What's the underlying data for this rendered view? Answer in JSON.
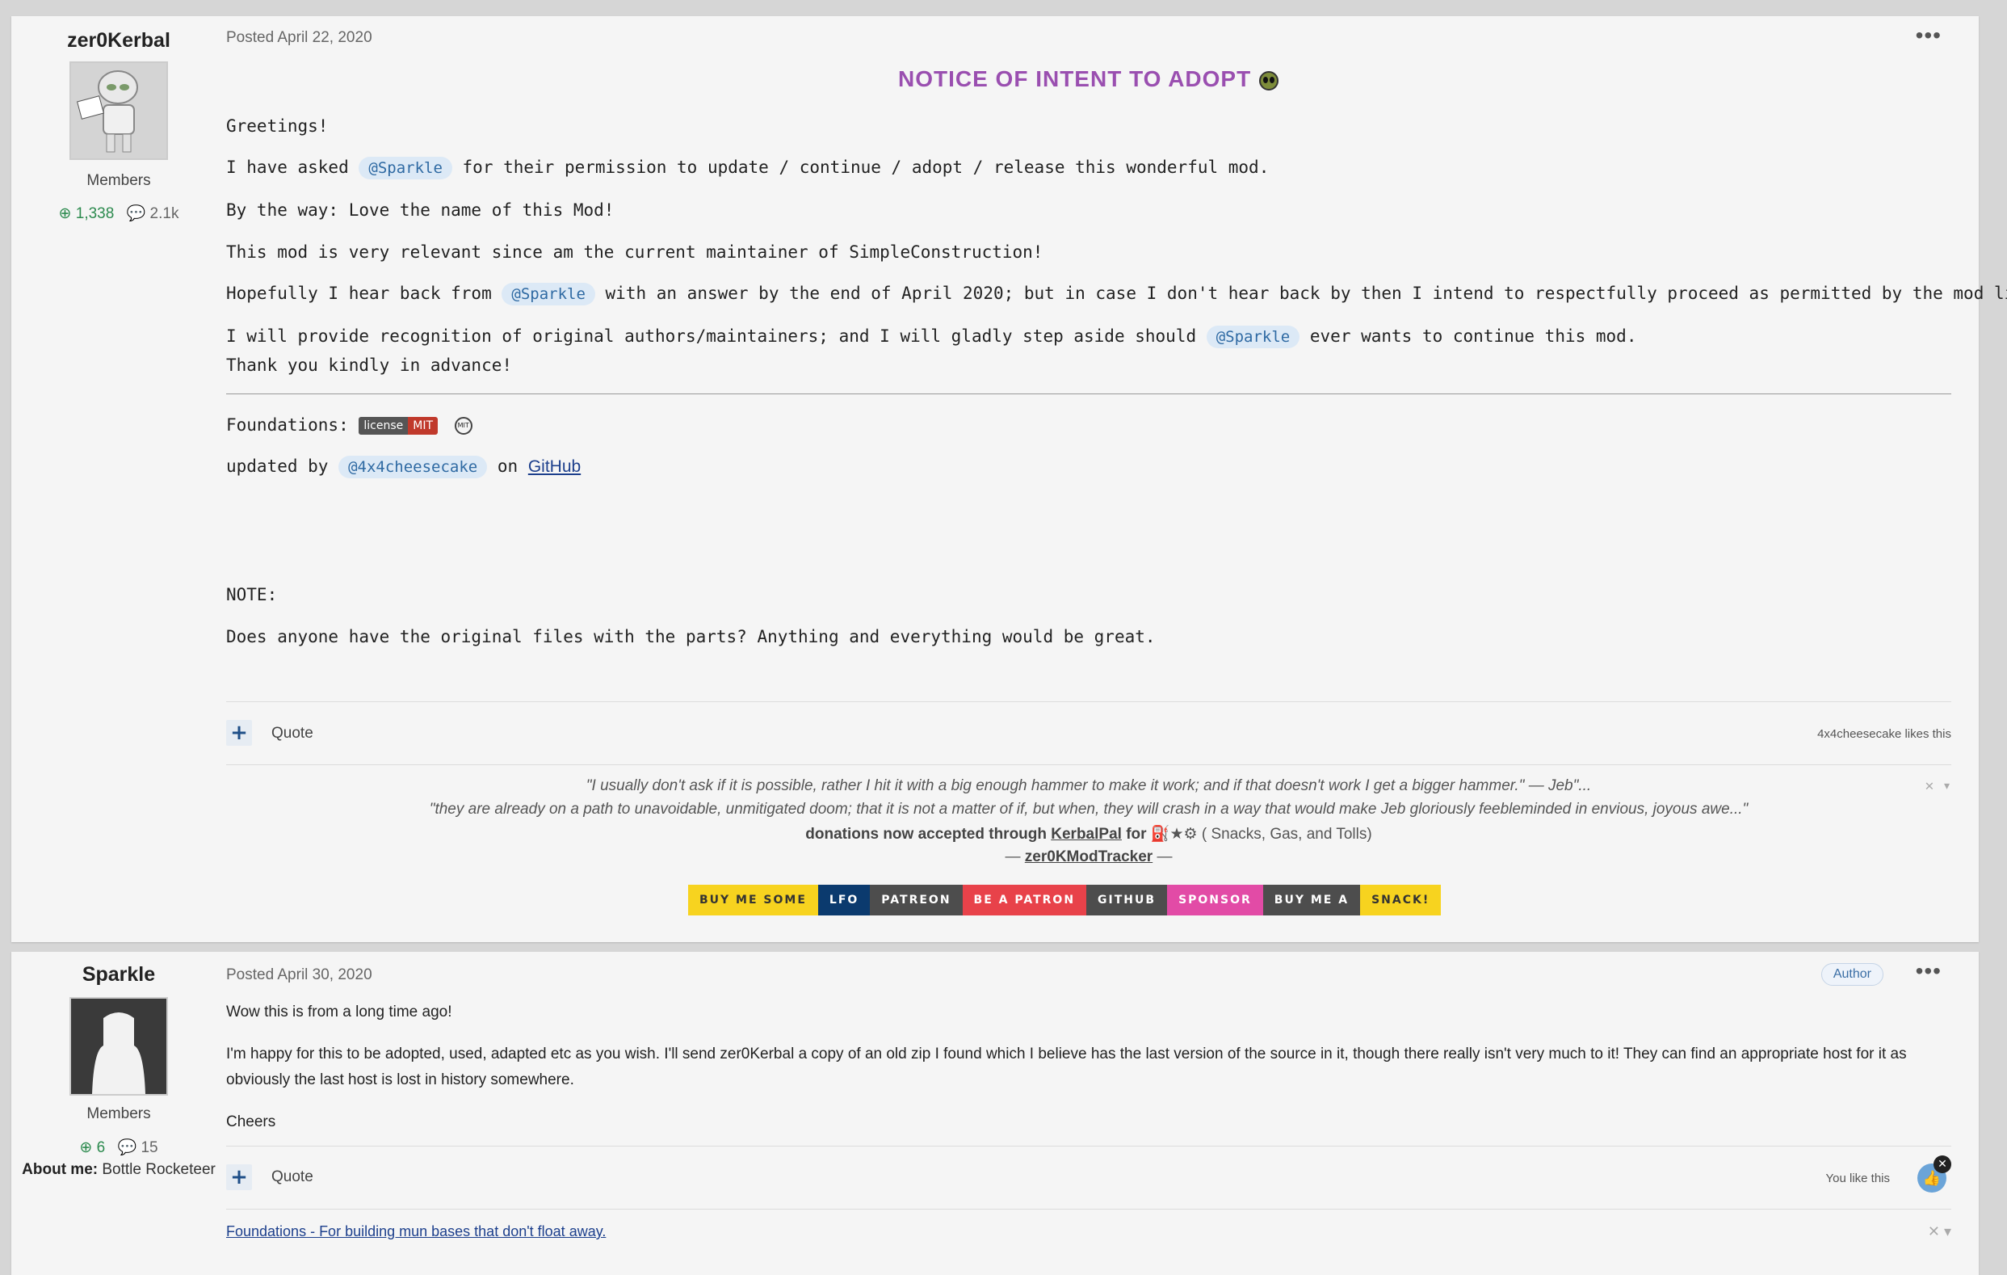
{
  "post1": {
    "author": "zer0Kerbal",
    "group": "Members",
    "reputation": "1,338",
    "post_count": "2.1k",
    "posted": "Posted April 22, 2020",
    "menu": "•••",
    "heading": "NOTICE OF INTENT TO ADOPT",
    "greeting": "Greetings!",
    "p1_before": "I have asked ",
    "p1_mention": "@Sparkle",
    "p1_after": " for their permission to update / continue / adopt / release this wonderful mod.",
    "p2": "By the way: Love the name of this Mod!",
    "p3": "This mod is very relevant since am the current maintainer of SimpleConstruction!",
    "p4_before": "Hopefully I hear back from ",
    "p4_mention": "@Sparkle",
    "p4_after": " with an answer by the end of April 2020; but in case I don't hear back by then I intend to respectfully proceed as permitted by the mod license.",
    "p5_before": "I will provide recognition of original authors/maintainers; and I will gladly step aside should ",
    "p5_mention": "@Sparkle",
    "p5_after": " ever wants to continue this mod.",
    "p6": "Thank you kindly in advance!",
    "foundations_label": "Foundations: ",
    "license_left": "license",
    "license_right": "MIT",
    "mit_icon": "MIT",
    "updated_before": "updated by ",
    "updated_mention": "@4x4cheesecake",
    "updated_mid": " on ",
    "updated_link": "GitHub",
    "note_label": "NOTE:",
    "note_text": "Does anyone have the original files with the parts? Anything and everything would be great.",
    "quote_label": "Quote",
    "likes_text": "4x4cheesecake likes this",
    "sig_line1": "\"I usually don't ask if it is possible, rather I hit it with a big enough hammer to make it work; and if that doesn't work I get a bigger hammer.\"  — Jeb\"...",
    "sig_line2": "\"they are already on a path to unavoidable, unmitigated doom; that it is not a matter of if, but when, they will crash in a way that would make Jeb gloriously feebleminded in envious, joyous awe...\"",
    "sig_line3_before": "donations now accepted through ",
    "sig_line3_link": "KerbalPal",
    "sig_line3_mid": " for ",
    "sig_line3_after": " ( Snacks, Gas, and Tolls)",
    "sig_line4_before": "— ",
    "sig_line4_link": "zer0KModTracker",
    "sig_line4_after": " —",
    "sig_close": "✕ ▾",
    "badges": [
      {
        "text": "BUY ME SOME",
        "bg": "#f7d31f",
        "fg": "#333"
      },
      {
        "text": "LFO",
        "bg": "#0b3a6e",
        "fg": "#ffffff"
      },
      {
        "text": "PATREON",
        "bg": "#4d4d4d",
        "fg": "#ffffff"
      },
      {
        "text": "BE A PATRON",
        "bg": "#e8424a",
        "fg": "#ffffff"
      },
      {
        "text": "GITHUB",
        "bg": "#4d4d4d",
        "fg": "#ffffff"
      },
      {
        "text": "SPONSOR",
        "bg": "#e24ba6",
        "fg": "#ffffff"
      },
      {
        "text": "BUY ME A",
        "bg": "#4d4d4d",
        "fg": "#ffffff"
      },
      {
        "text": "SNACK!",
        "bg": "#f7d31f",
        "fg": "#333"
      }
    ]
  },
  "post2": {
    "author": "Sparkle",
    "group": "Members",
    "reputation": "6",
    "post_count": "15",
    "about_label": "About me:",
    "about_value": " Bottle Rocketeer",
    "posted": "Posted April 30, 2020",
    "author_badge": "Author",
    "menu": "•••",
    "p1": "Wow this is from a long time ago!",
    "p2_line1": "I'm happy for this to be adopted, used, adapted etc as you wish. I'll send zer0Kerbal a copy of an old zip I found which I believe has the last version of the source in it, though there really isn't very much to it! They can find an appropriate host for it as",
    "p2_line2": "obviously the last host is lost in history somewhere.",
    "p3": "Cheers",
    "quote_label": "Quote",
    "likes_text": "You like this",
    "sig_link": "Foundations - For building mun bases that don't float away.",
    "sig_close": "✕ ▾"
  },
  "colors": {
    "heading": "#9a4fb0",
    "mention_bg": "#dce9f6",
    "reputation": "#2c8a4e"
  }
}
